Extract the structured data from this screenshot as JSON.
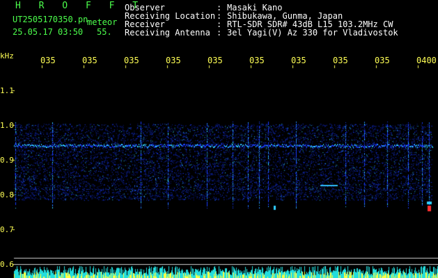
{
  "brand": {
    "logo": "H R O F F T"
  },
  "file": {
    "filename": "UT2505170350.pn",
    "type": "meteor",
    "datetime": "25.05.17 03:50",
    "count": "55."
  },
  "header": {
    "rows": [
      {
        "label": "Observer",
        "value": "Masaki Kano"
      },
      {
        "label": "Receiving Location",
        "value": "Shibukawa, Gunma, Japan"
      },
      {
        "label": "Receiver",
        "value": "RTL-SDR SDR# 43dB L15 103.2MHz CW"
      },
      {
        "label": "Receiving Antenna",
        "value": "3el Yagi(V) Az 330 for Vladivostok"
      }
    ],
    "colon": ":"
  },
  "time_axis": {
    "ticks": [
      "035",
      "035",
      "035",
      "035",
      "035",
      "035",
      "035",
      "035",
      "035",
      "0400"
    ]
  },
  "freq_axis": {
    "unit": "kHz",
    "labels": [
      "1.1",
      "1.0",
      "0.9",
      "0.8",
      "0.7",
      "0.6"
    ]
  },
  "colors": {
    "text_green": "#4cff4c",
    "text_white": "#ffffff",
    "tick_yellow": "#ffff55",
    "signal_blue": "#1a3cff",
    "signal_cyan": "#30d0ff",
    "signal_red": "#ff3030"
  }
}
